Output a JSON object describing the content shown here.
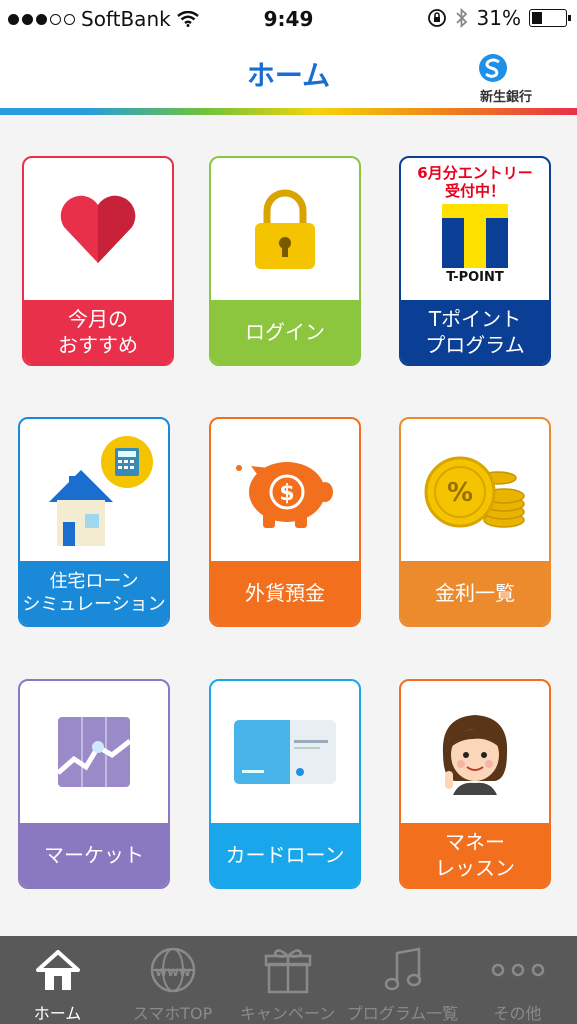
{
  "status": {
    "carrier": "SoftBank",
    "time": "9:49",
    "battery": "31%"
  },
  "header": {
    "title": "ホーム",
    "logo_text": "新生銀行"
  },
  "tiles": [
    {
      "label1": "今月の",
      "label2": "おすすめ",
      "color": "#e8304a"
    },
    {
      "label1": "ログイン",
      "label2": "",
      "color": "#8cc63f"
    },
    {
      "badge1": "6月分エントリー",
      "badge2": "受付中！",
      "tpoint": "T-POINT",
      "label1": "Tポイント",
      "label2": "プログラム",
      "color": "#0b3f96"
    },
    {
      "label1": "住宅ローン",
      "label2": "シミュレーション",
      "color": "#1a8ad8"
    },
    {
      "label1": "外貨預金",
      "label2": "",
      "color": "#f26f1e"
    },
    {
      "label1": "金利一覧",
      "label2": "",
      "color": "#ec8a2e"
    },
    {
      "label1": "マーケット",
      "label2": "",
      "color": "#8a78c0"
    },
    {
      "label1": "カードローン",
      "label2": "",
      "color": "#1aa6ea"
    },
    {
      "label1": "マネー",
      "label2": "レッスン",
      "color": "#f26f1e"
    }
  ],
  "tabs": [
    {
      "label": "ホーム",
      "icon": "home-icon"
    },
    {
      "label": "スマホTOP",
      "icon": "globe-icon"
    },
    {
      "label": "キャンペーン",
      "icon": "gift-icon"
    },
    {
      "label": "プログラム一覧",
      "icon": "music-note-icon"
    },
    {
      "label": "その他",
      "icon": "more-icon"
    }
  ]
}
